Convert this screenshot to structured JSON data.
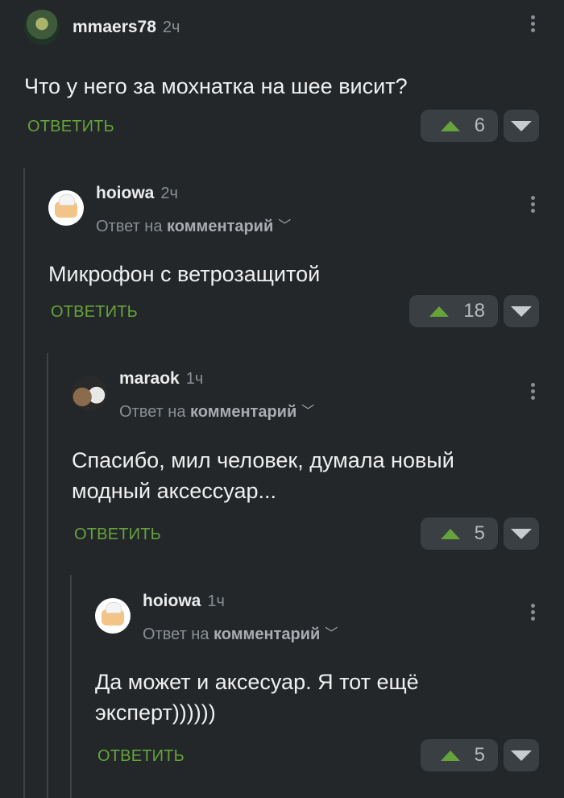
{
  "reply_to_prefix": "Ответ на",
  "reply_to_link": "комментарий",
  "reply_label": "ОТВЕТИТЬ",
  "colors": {
    "accent": "#66a33a",
    "background": "#23272a",
    "button_bg": "#3a3f43"
  },
  "comments": [
    {
      "author": "mmaers78",
      "time": "2ч",
      "reply_to": false,
      "text": "Что у него за мохнатка на шее висит?",
      "votes": "6"
    },
    {
      "author": "hoiowa",
      "time": "2ч",
      "reply_to": true,
      "text": "Микрофон с ветрозащитой",
      "votes": "18"
    },
    {
      "author": "maraok",
      "time": "1ч",
      "reply_to": true,
      "text_lines": [
        "Спасибо, мил человек, думала новый",
        "модный аксессуар..."
      ],
      "votes": "5"
    },
    {
      "author": "hoiowa",
      "time": "1ч",
      "reply_to": true,
      "text_lines": [
        "Да может и аксесуар. Я тот ещё",
        "эксперт))))))"
      ],
      "votes": "5"
    }
  ]
}
